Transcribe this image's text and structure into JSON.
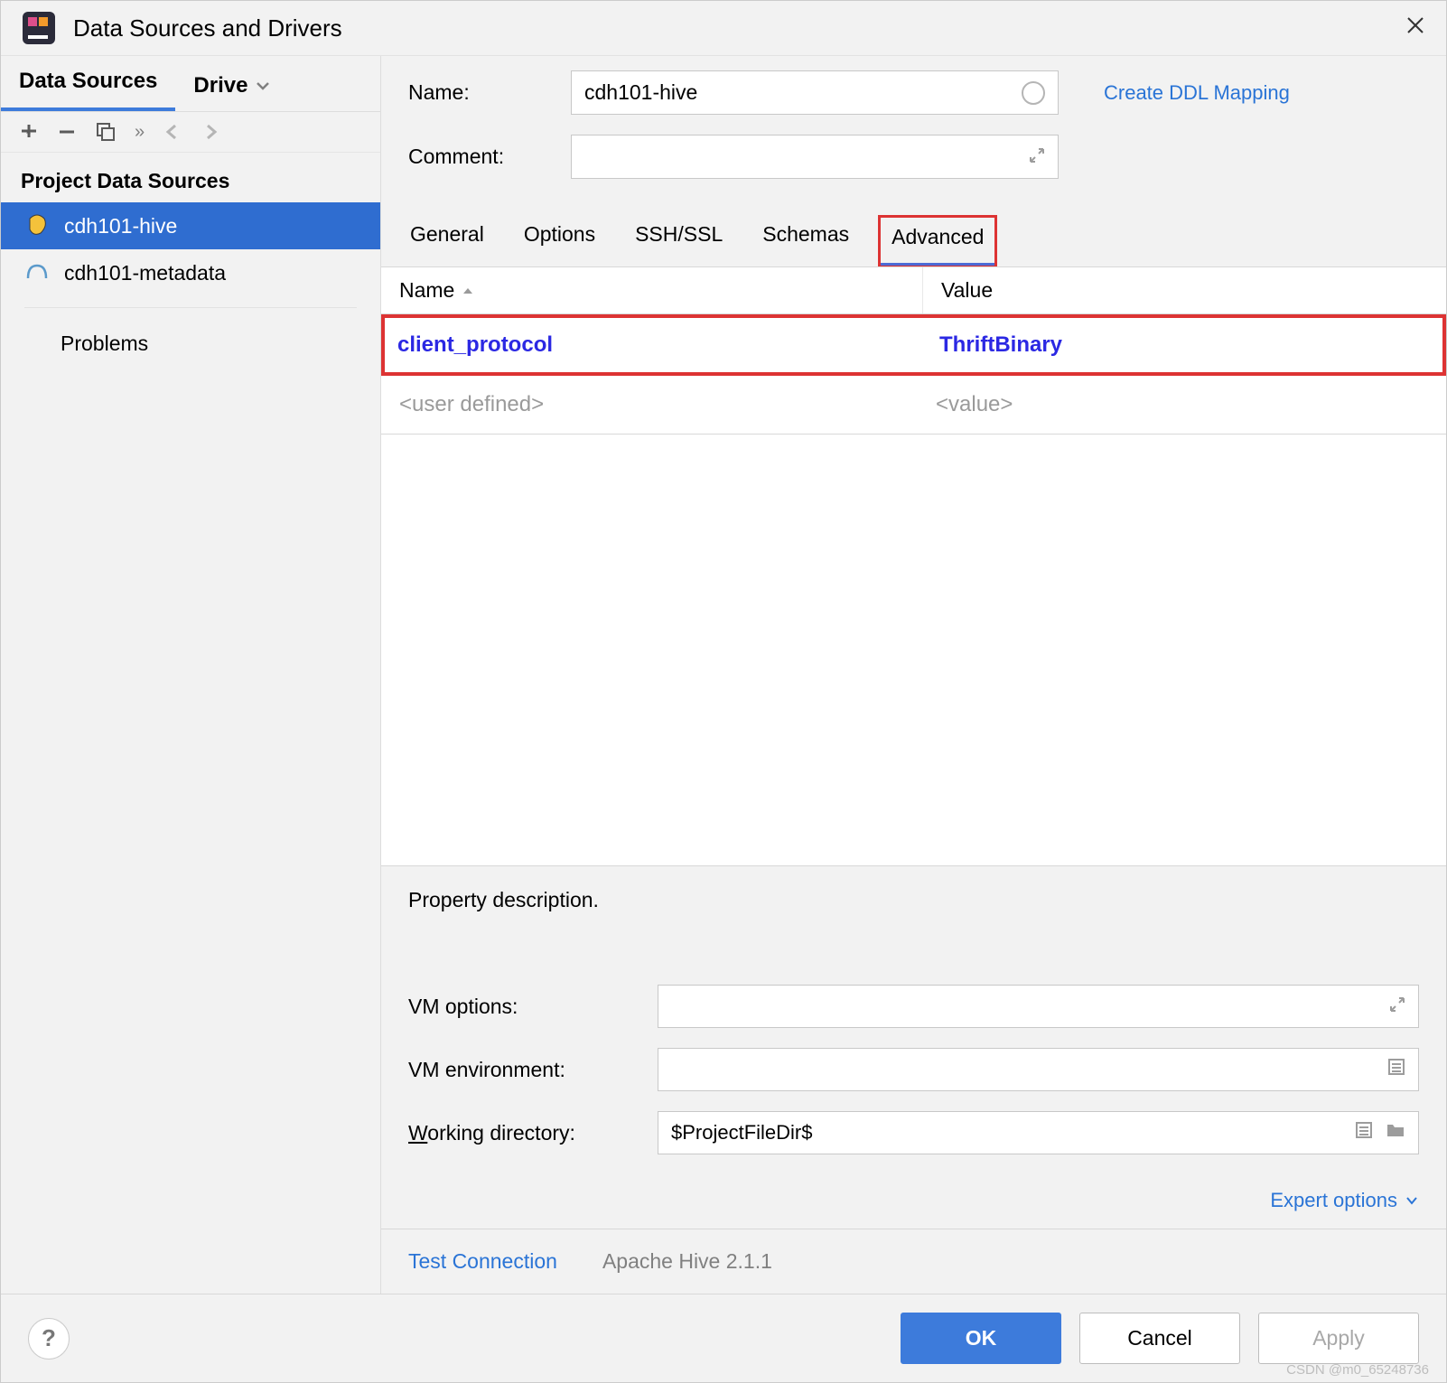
{
  "window": {
    "title": "Data Sources and Drivers"
  },
  "sidebar": {
    "tabs": {
      "active": "Data Sources",
      "other": "Drive"
    },
    "section": "Project Data Sources",
    "items": [
      {
        "label": "cdh101-hive",
        "selected": true
      },
      {
        "label": "cdh101-metadata",
        "selected": false
      }
    ],
    "problems": "Problems"
  },
  "form": {
    "name_label": "Name:",
    "name_value": "cdh101-hive",
    "comment_label": "Comment:",
    "ddl_link": "Create DDL Mapping"
  },
  "tabs": [
    "General",
    "Options",
    "SSH/SSL",
    "Schemas",
    "Advanced"
  ],
  "active_tab": "Advanced",
  "table": {
    "headers": {
      "name": "Name",
      "value": "Value"
    },
    "rows": [
      {
        "name": "client_protocol",
        "value": "ThriftBinary",
        "highlight": true
      }
    ],
    "placeholder": {
      "name": "<user defined>",
      "value": "<value>"
    }
  },
  "property_description": "Property description.",
  "vm_options_label": "VM options:",
  "vm_env_label": "VM environment:",
  "workdir_label_prefix": "W",
  "workdir_label_rest": "orking directory:",
  "workdir_value": "$ProjectFileDir$",
  "expert_options": "Expert options",
  "test_connection": "Test Connection",
  "driver_info": "Apache Hive 2.1.1",
  "buttons": {
    "ok": "OK",
    "cancel": "Cancel",
    "apply": "Apply"
  },
  "watermark": "CSDN @m0_65248736"
}
